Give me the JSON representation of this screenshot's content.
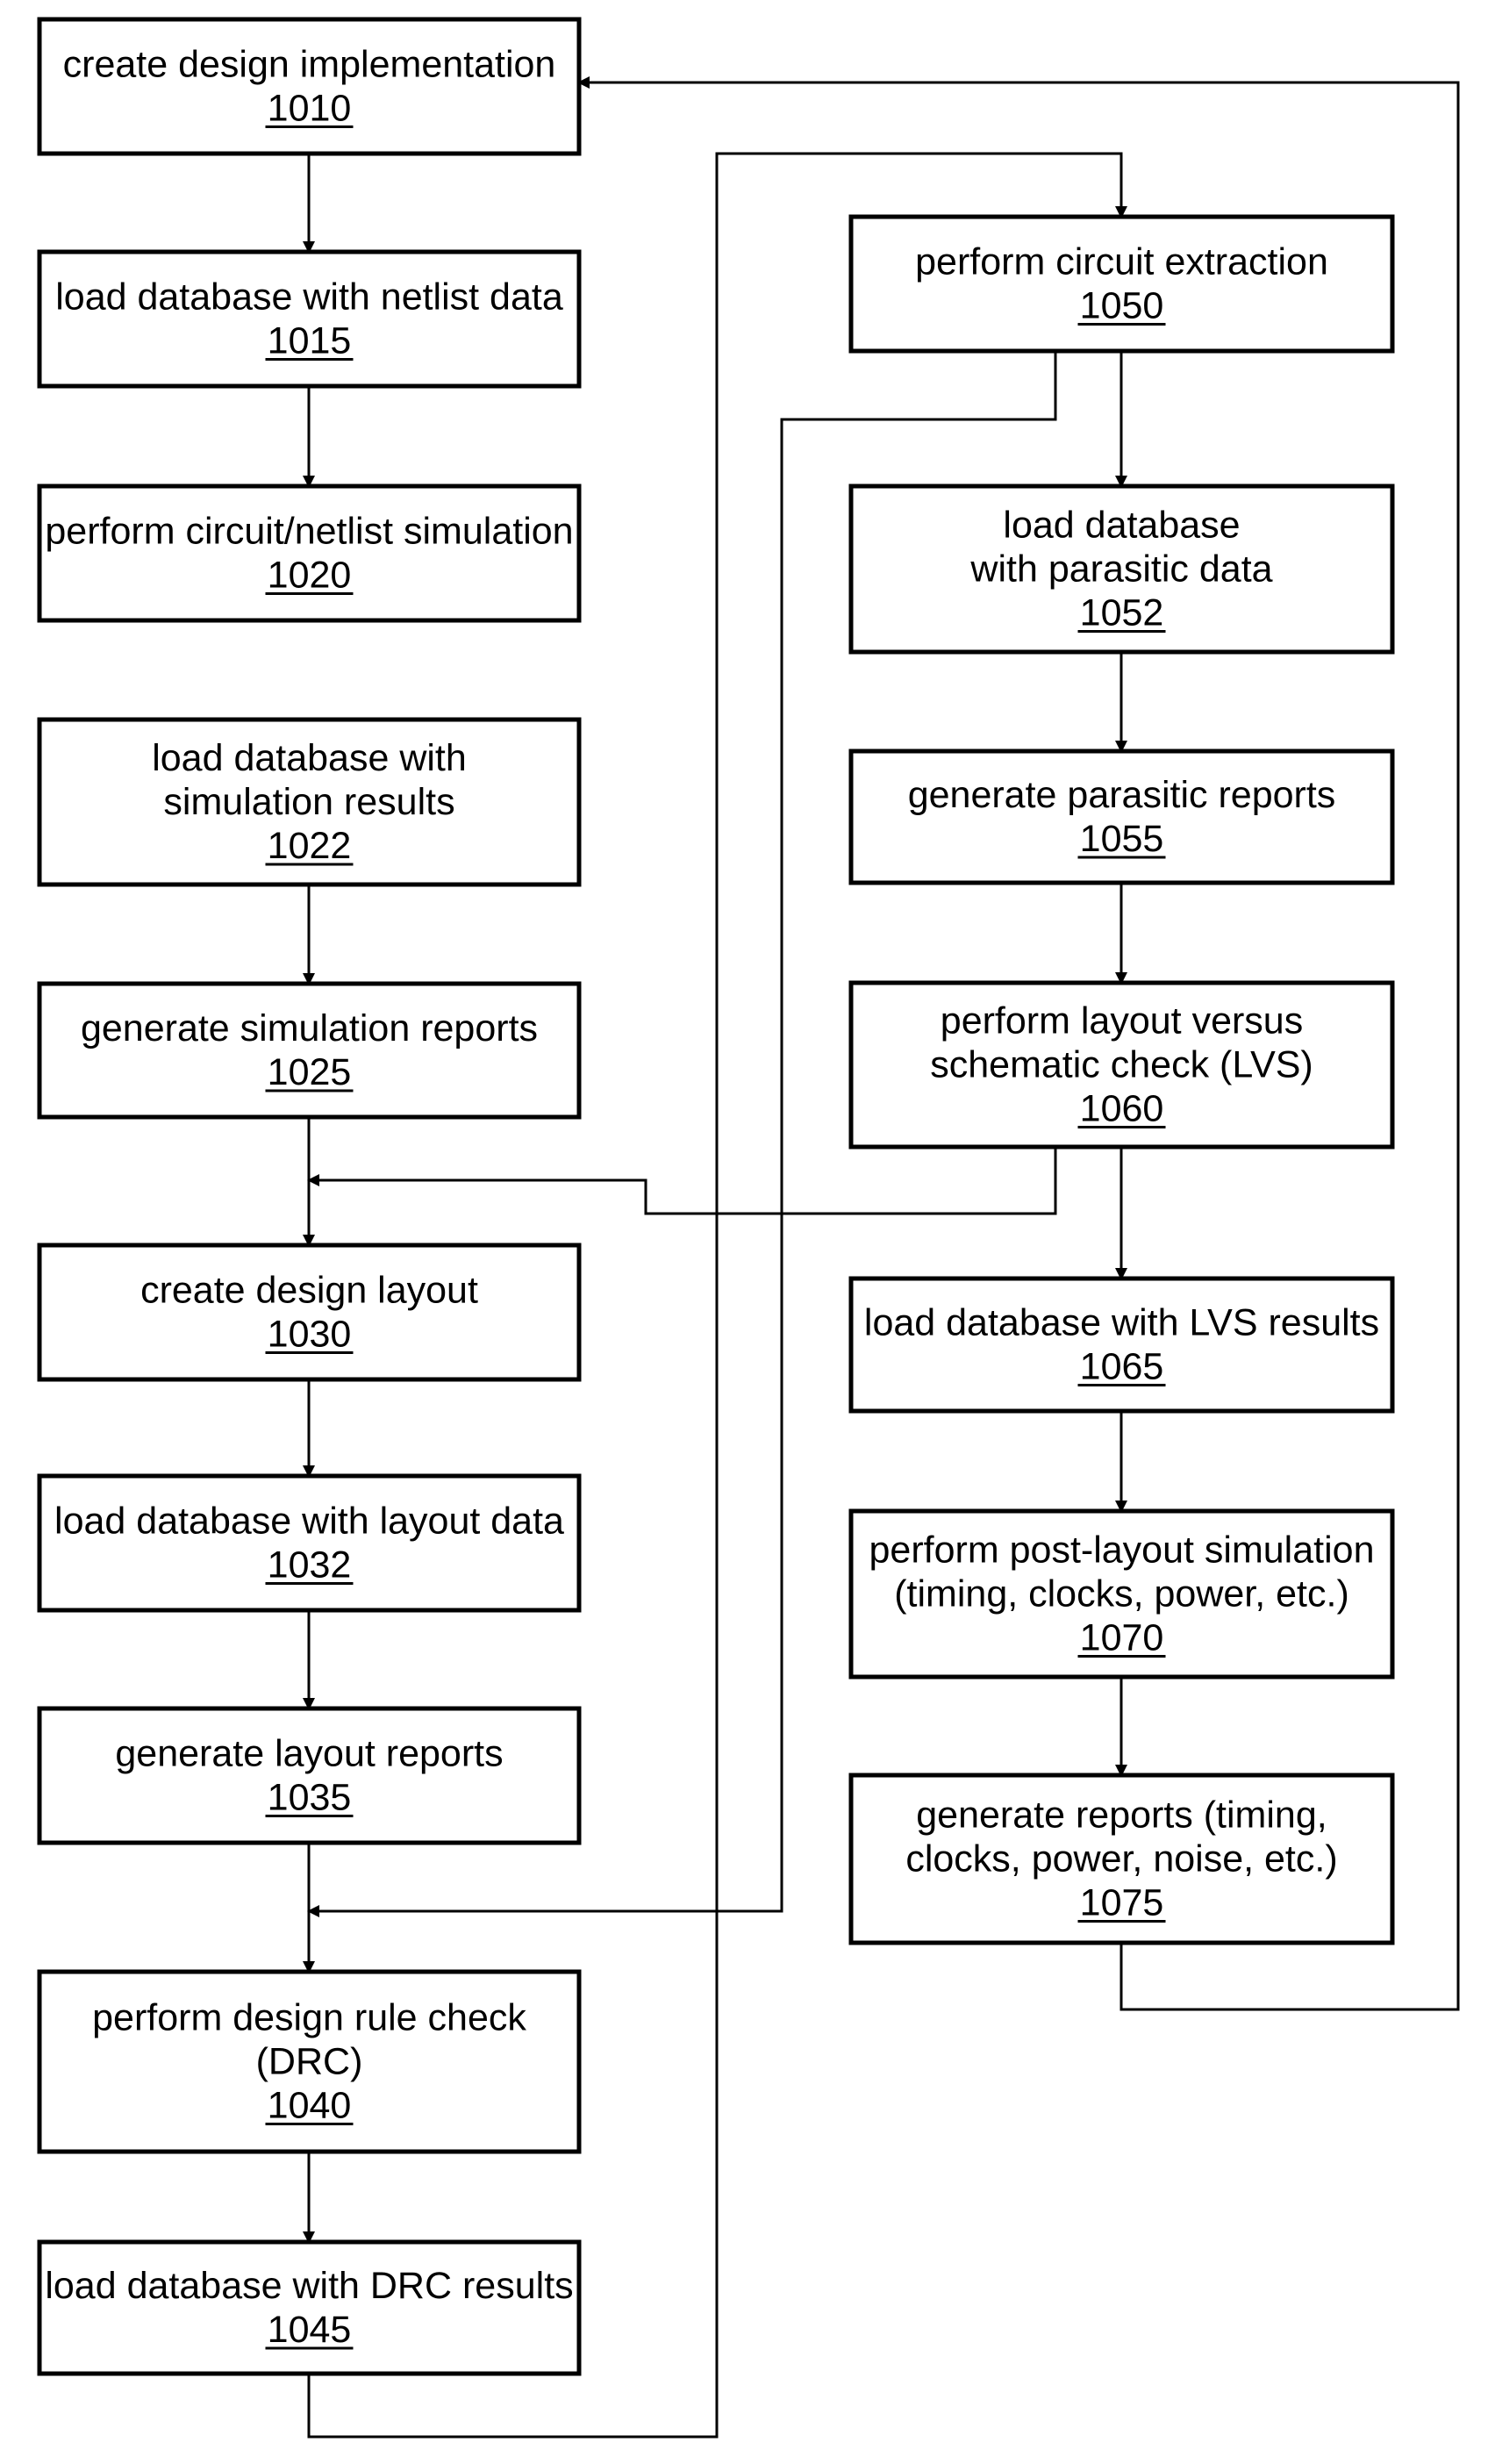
{
  "diagram": {
    "type": "flowchart",
    "steps": [
      {
        "id": "1010",
        "lines": [
          "create design implementation"
        ]
      },
      {
        "id": "1015",
        "lines": [
          "load database with netlist data"
        ]
      },
      {
        "id": "1020",
        "lines": [
          "perform circuit/netlist simulation"
        ]
      },
      {
        "id": "1022",
        "lines": [
          "load database with",
          "simulation results"
        ]
      },
      {
        "id": "1025",
        "lines": [
          "generate simulation reports"
        ]
      },
      {
        "id": "1030",
        "lines": [
          "create design layout"
        ]
      },
      {
        "id": "1032",
        "lines": [
          "load database with layout data"
        ]
      },
      {
        "id": "1035",
        "lines": [
          "generate layout reports"
        ]
      },
      {
        "id": "1040",
        "lines": [
          "perform design rule check",
          "(DRC)"
        ]
      },
      {
        "id": "1045",
        "lines": [
          "load database with DRC results"
        ]
      },
      {
        "id": "1050",
        "lines": [
          "perform circuit extraction"
        ]
      },
      {
        "id": "1052",
        "lines": [
          "load database",
          "with parasitic data"
        ]
      },
      {
        "id": "1055",
        "lines": [
          "generate parasitic reports"
        ]
      },
      {
        "id": "1060",
        "lines": [
          "perform layout versus",
          "schematic check (LVS)"
        ]
      },
      {
        "id": "1065",
        "lines": [
          "load database with LVS results"
        ]
      },
      {
        "id": "1070",
        "lines": [
          "perform post-layout simulation",
          "(timing, clocks, power, etc.)"
        ]
      },
      {
        "id": "1075",
        "lines": [
          "generate reports (timing,",
          "clocks, power, noise, etc.)"
        ]
      }
    ],
    "edges": [
      {
        "from": "1010",
        "to": "1015"
      },
      {
        "from": "1015",
        "to": "1020"
      },
      {
        "from": "1022",
        "to": "1025"
      },
      {
        "from": "1025",
        "to": "1030"
      },
      {
        "from": "1060",
        "to": "1030"
      },
      {
        "from": "1030",
        "to": "1032"
      },
      {
        "from": "1032",
        "to": "1035"
      },
      {
        "from": "1035",
        "to": "1040"
      },
      {
        "from": "1050",
        "to": "1040"
      },
      {
        "from": "1040",
        "to": "1045"
      },
      {
        "from": "1045",
        "to": "1050"
      },
      {
        "from": "1050",
        "to": "1052"
      },
      {
        "from": "1052",
        "to": "1055"
      },
      {
        "from": "1055",
        "to": "1060"
      },
      {
        "from": "1060",
        "to": "1065"
      },
      {
        "from": "1065",
        "to": "1070"
      },
      {
        "from": "1070",
        "to": "1075"
      },
      {
        "from": "1075",
        "to": "1010"
      }
    ]
  }
}
